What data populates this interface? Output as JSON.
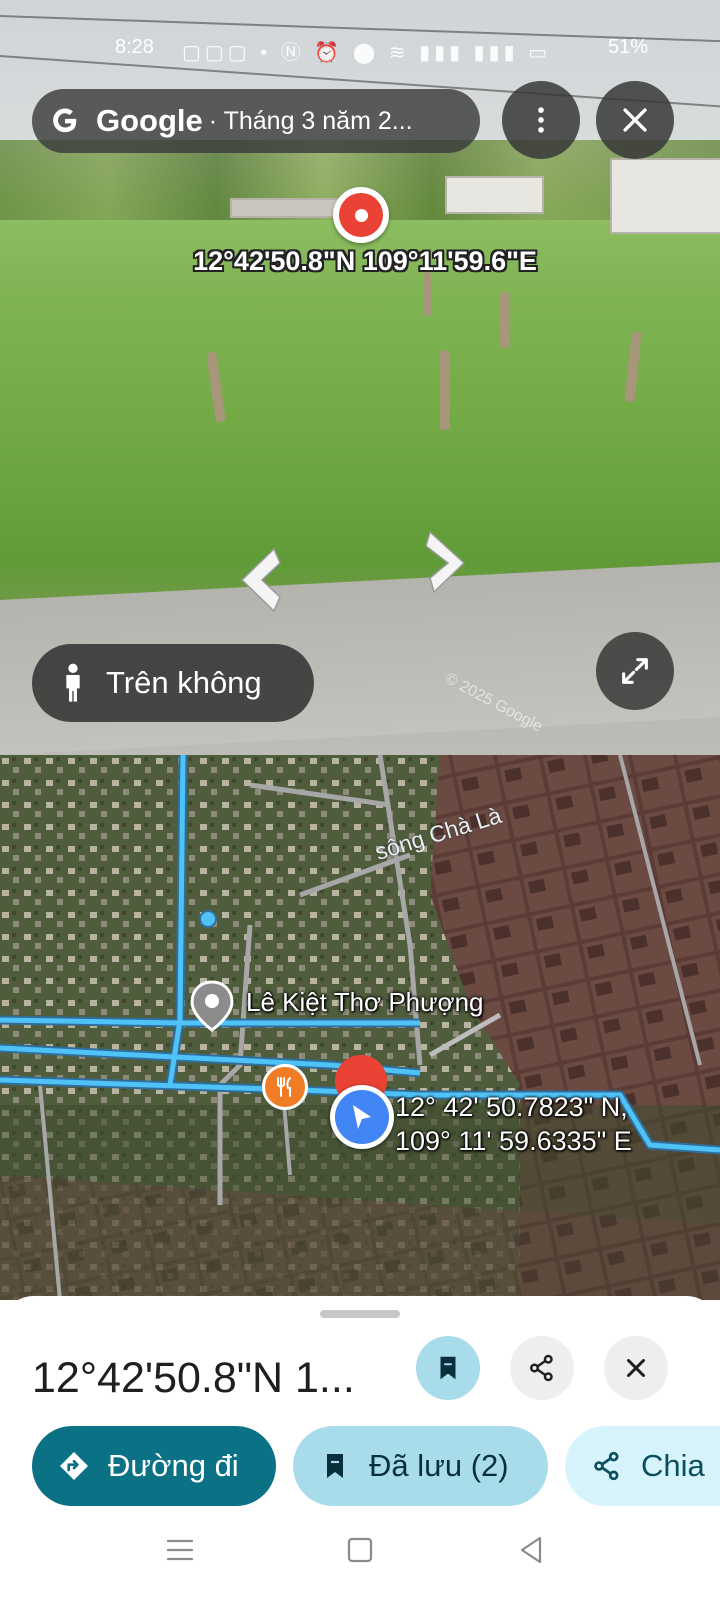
{
  "status_bar": {
    "time": "8:28",
    "icons": [
      "zalo-icon",
      "zalo-icon",
      "zalo-icon",
      "dot-icon",
      "nfc-icon",
      "alarm-icon",
      "location-icon",
      "wifi-icon",
      "signal-icon",
      "signal-icon",
      "battery-icon"
    ],
    "battery": "51%"
  },
  "street_view": {
    "brand": "Google",
    "capture_date": "· Tháng 3 năm 2...",
    "pin_coords": "12°42'50.8\"N 109°11'59.6\"E",
    "mode_label": "Trên không",
    "watermark": "© 2025 Google"
  },
  "map": {
    "river_label": "sông Chà Là",
    "place_label": "Lê Kiệt Thơ Phượng",
    "coords_line1": "12° 42' 50.7823\" N,",
    "coords_line2": "109° 11' 59.6335\" E"
  },
  "sheet": {
    "title": "12°42'50.8\"N 1...",
    "chips": {
      "directions": "Đường đi",
      "saved": "Đã lưu (2)",
      "share": "Chia"
    }
  },
  "colors": {
    "teal": "#0b7285",
    "saved_chip": "#a9dcea",
    "share_chip": "#d7f3fb",
    "pin_red": "#ea4335",
    "route_blue": "#4fc3f7"
  }
}
